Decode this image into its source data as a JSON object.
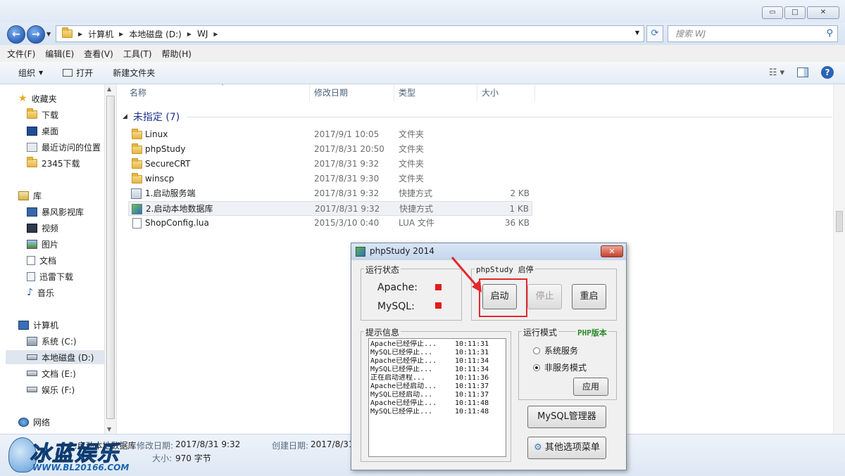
{
  "window": {
    "buttons": [
      "▭",
      "□",
      "✕"
    ]
  },
  "address": {
    "crumbs": [
      "计算机",
      "本地磁盘 (D:)",
      "WJ"
    ],
    "search_placeholder": "搜索 WJ"
  },
  "menu": [
    "文件(F)",
    "编辑(E)",
    "查看(V)",
    "工具(T)",
    "帮助(H)"
  ],
  "toolbar": {
    "organize": "组织",
    "open": "打开",
    "new_folder": "新建文件夹"
  },
  "nav": {
    "favorites": "收藏夹",
    "downloads": "下载",
    "desktop": "桌面",
    "recent": "最近访问的位置",
    "downloads2345": "2345下载",
    "libraries": "库",
    "storm_video": "暴风影视库",
    "videos": "视频",
    "pictures": "图片",
    "documents": "文档",
    "thunder": "迅雷下载",
    "music": "音乐",
    "computer": "计算机",
    "drive_c": "系统 (C:)",
    "drive_d": "本地磁盘 (D:)",
    "drive_e": "文档 (E:)",
    "drive_f": "娱乐 (F:)",
    "network": "网络"
  },
  "columns": {
    "name": "名称",
    "modified": "修改日期",
    "type": "类型",
    "size": "大小"
  },
  "group_header": "未指定 (7)",
  "files": [
    {
      "name": "Linux",
      "date": "2017/9/1 10:05",
      "type": "文件夹",
      "size": ""
    },
    {
      "name": "phpStudy",
      "date": "2017/8/31 20:50",
      "type": "文件夹",
      "size": ""
    },
    {
      "name": "SecureCRT",
      "date": "2017/8/31 9:32",
      "type": "文件夹",
      "size": ""
    },
    {
      "name": "winscp",
      "date": "2017/8/31 9:30",
      "type": "文件夹",
      "size": ""
    },
    {
      "name": "1.启动服务端",
      "date": "2017/8/31 9:32",
      "type": "快捷方式",
      "size": "2 KB"
    },
    {
      "name": "2.启动本地数据库",
      "date": "2017/8/31 9:32",
      "type": "快捷方式",
      "size": "1 KB"
    },
    {
      "name": "ShopConfig.lua",
      "date": "2015/3/10 0:40",
      "type": "LUA 文件",
      "size": "36 KB"
    }
  ],
  "details": {
    "name": "2.启动本地数据库",
    "modified_label": "修改日期:",
    "modified_value": "2017/8/31 9:32",
    "created_label": "创建日期:",
    "created_value": "2017/8/31",
    "size_label": "大小:",
    "size_value": "970 字节"
  },
  "watermark": {
    "title": "冰蓝娱乐",
    "url": "WWW.BL20166.COM"
  },
  "dialog": {
    "title": "phpStudy 2014",
    "close": "✕",
    "status_group": "运行状态",
    "apache_label": "Apache:",
    "mysql_label": "MySQL:",
    "control_group": "phpStudy 启停",
    "start": "启动",
    "stop": "停止",
    "restart": "重启",
    "log_group": "提示信息",
    "log": [
      {
        "msg": "Apache已经停止...",
        "time": "10:11:31"
      },
      {
        "msg": "MySQL已经停止...",
        "time": "10:11:31"
      },
      {
        "msg": "Apache已经停止...",
        "time": "10:11:34"
      },
      {
        "msg": "MySQL已经停止...",
        "time": "10:11:34"
      },
      {
        "msg": "正在启动进程...",
        "time": "10:11:36"
      },
      {
        "msg": "Apache已经启动...",
        "time": "10:11:37"
      },
      {
        "msg": "MySQL已经启动...",
        "time": "10:11:37"
      },
      {
        "msg": "Apache已经停止...",
        "time": "10:11:48"
      },
      {
        "msg": "MySQL已经停止...",
        "time": "10:11:48"
      }
    ],
    "mode_group": "运行模式",
    "php_version": "PHP版本",
    "mode_system": "系统服务",
    "mode_nonservice": "非服务模式",
    "apply": "应用",
    "mysql_manager": "MySQL管理器",
    "other_menu": "其他选项菜单"
  },
  "colors": {
    "status_red": "#e31b1b",
    "highlight_red": "#e3282d",
    "php_green": "#2a8a2a",
    "group_blue": "#1e3287"
  }
}
